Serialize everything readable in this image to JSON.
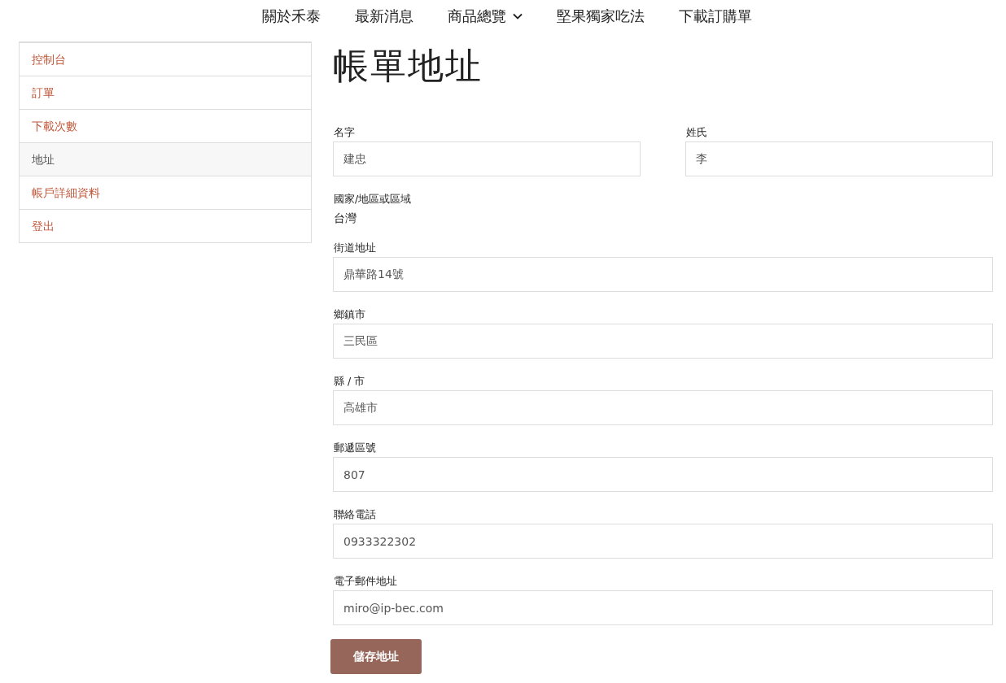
{
  "nav": [
    {
      "label": "關於禾泰",
      "has_dropdown": false
    },
    {
      "label": "最新消息",
      "has_dropdown": false
    },
    {
      "label": "商品總覽",
      "has_dropdown": true
    },
    {
      "label": "堅果獨家吃法",
      "has_dropdown": false
    },
    {
      "label": "下載訂購單",
      "has_dropdown": false
    }
  ],
  "account_menu": [
    {
      "label": "控制台",
      "selected": false
    },
    {
      "label": "訂單",
      "selected": false
    },
    {
      "label": "下載次數",
      "selected": false
    },
    {
      "label": "地址",
      "selected": true
    },
    {
      "label": "帳戶詳細資料",
      "selected": false
    },
    {
      "label": "登出",
      "selected": false
    }
  ],
  "title": "帳單地址",
  "fields": [
    {
      "kind": "half",
      "label": "名字",
      "value": "建忠"
    },
    {
      "kind": "half",
      "label": "姓氏",
      "value": "李"
    },
    {
      "kind": "static",
      "label": "國家/地區或區域",
      "value": "台灣"
    },
    {
      "kind": "full",
      "label": "街道地址",
      "value": "鼎華路14號"
    },
    {
      "kind": "full",
      "label": "鄉鎮市",
      "value": "三民區"
    },
    {
      "kind": "full",
      "label": "縣 / 市",
      "value": "高雄市"
    },
    {
      "kind": "full",
      "label": "郵遞區號",
      "value": "807"
    },
    {
      "kind": "full",
      "label": "聯絡電話",
      "value": "0933322302"
    },
    {
      "kind": "full",
      "label": "電子郵件地址",
      "value": "miro@ip-bec.com"
    }
  ],
  "save_button": "儲存地址"
}
